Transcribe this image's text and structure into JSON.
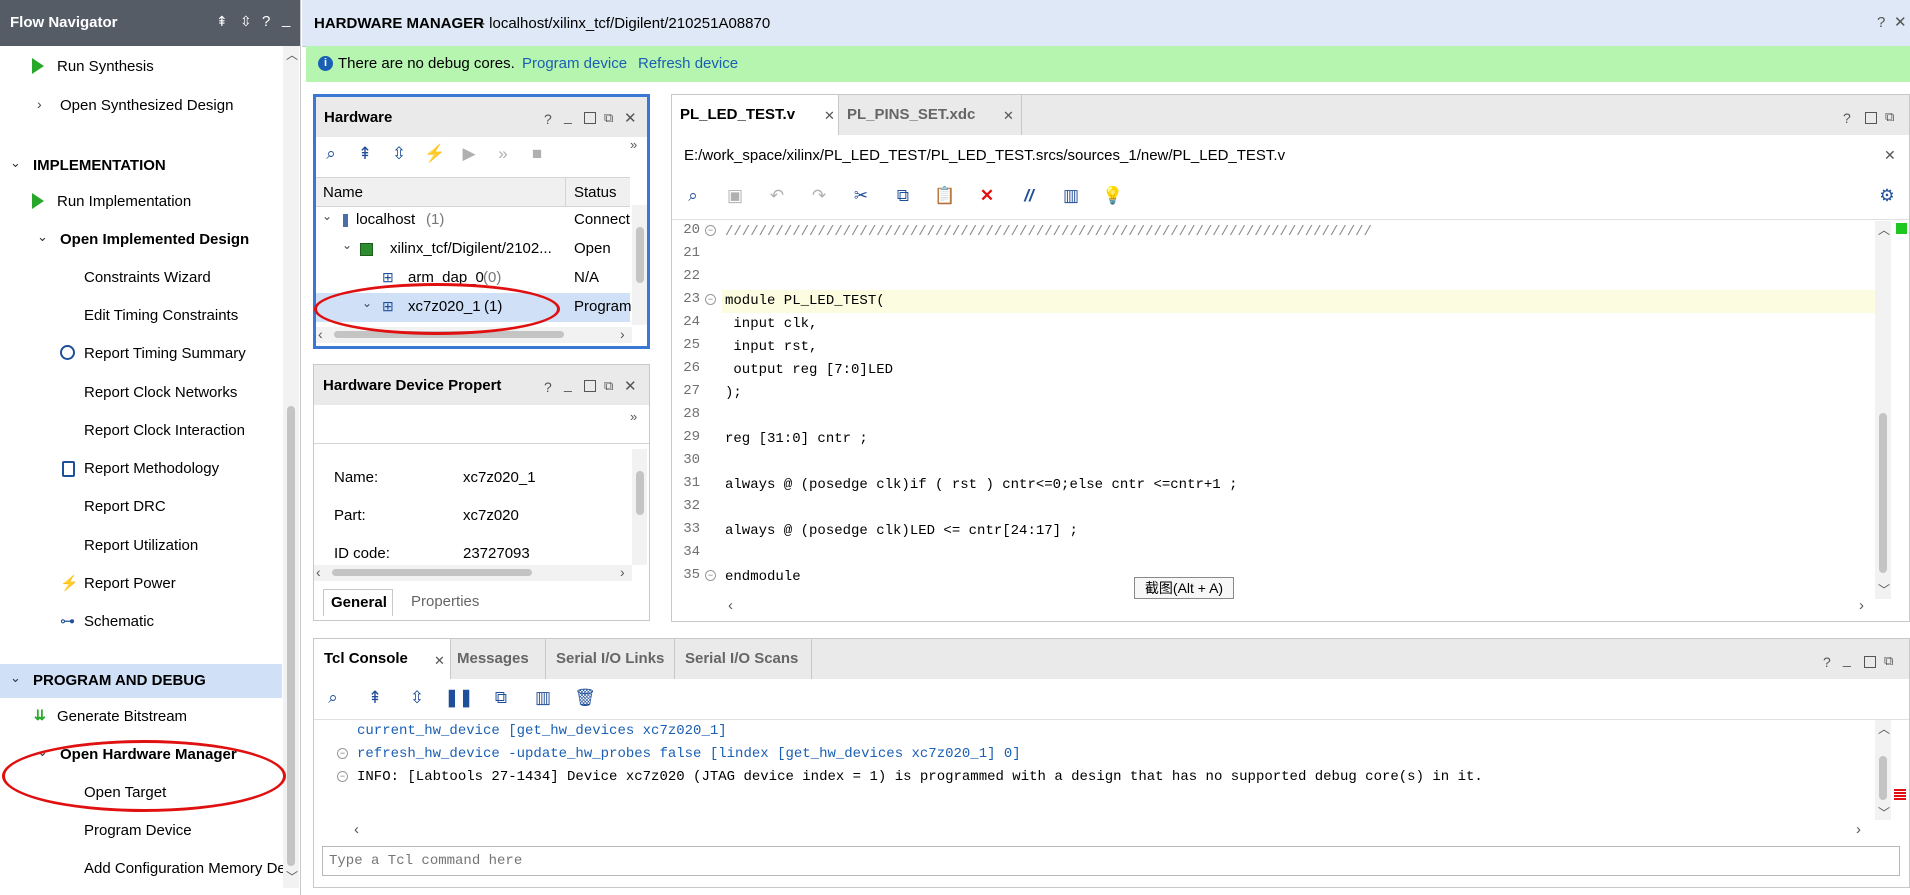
{
  "flow_navigator": {
    "title": "Flow Navigator",
    "items": [
      {
        "label": "Run Synthesis"
      },
      {
        "label": "Open Synthesized Design"
      },
      {
        "label": "IMPLEMENTATION"
      },
      {
        "label": "Run Implementation"
      },
      {
        "label": "Open Implemented Design"
      },
      {
        "label": "Constraints Wizard"
      },
      {
        "label": "Edit Timing Constraints"
      },
      {
        "label": "Report Timing Summary"
      },
      {
        "label": "Report Clock Networks"
      },
      {
        "label": "Report Clock Interaction"
      },
      {
        "label": "Report Methodology"
      },
      {
        "label": "Report DRC"
      },
      {
        "label": "Report Utilization"
      },
      {
        "label": "Report Power"
      },
      {
        "label": "Schematic"
      },
      {
        "label": "PROGRAM AND DEBUG"
      },
      {
        "label": "Generate Bitstream"
      },
      {
        "label": "Open Hardware Manager"
      },
      {
        "label": "Open Target"
      },
      {
        "label": "Program Device"
      },
      {
        "label": "Add Configuration Memory Dev"
      }
    ]
  },
  "header": {
    "title": "HARDWARE MANAGER",
    "path": " - localhost/xilinx_tcf/Digilent/210251A08870"
  },
  "banner": {
    "message": "There are no debug cores.",
    "link1": "Program device",
    "link2": "Refresh device",
    "color": "#b6f5b0"
  },
  "hardware_panel": {
    "title": "Hardware",
    "col_name": "Name",
    "col_status": "Status",
    "rows": [
      {
        "name": "localhost",
        "count": " (1)",
        "status": "Connect"
      },
      {
        "name": "xilinx_tcf/Digilent/2102...",
        "count": "",
        "status": "Open"
      },
      {
        "name": "arm_dap_0",
        "count": " (0)",
        "status": "N/A"
      },
      {
        "name": "xc7z020_1",
        "count": " (1)",
        "status": "Program"
      }
    ]
  },
  "device_props": {
    "title": "Hardware Device Propert",
    "props": [
      {
        "key": "Name:",
        "value": "xc7z020_1"
      },
      {
        "key": "Part:",
        "value": "xc7z020"
      },
      {
        "key": "ID code:",
        "value": "23727093"
      }
    ],
    "tab_general": "General",
    "tab_properties": "Properties"
  },
  "editor": {
    "tabs": [
      {
        "label": "PL_LED_TEST.v"
      },
      {
        "label": "PL_PINS_SET.xdc"
      }
    ],
    "file_path": "E:/work_space/xilinx/PL_LED_TEST/PL_LED_TEST.srcs/sources_1/new/PL_LED_TEST.v",
    "tooltip": "截图(Alt + A)",
    "lines": [
      {
        "n": "20",
        "t": "/////////////////////////////////////////////////////////////////////////////"
      },
      {
        "n": "21",
        "t": ""
      },
      {
        "n": "22",
        "t": ""
      },
      {
        "n": "23",
        "t": "module PL_LED_TEST("
      },
      {
        "n": "24",
        "t": " input clk,"
      },
      {
        "n": "25",
        "t": " input rst,"
      },
      {
        "n": "26",
        "t": " output reg [7:0]LED"
      },
      {
        "n": "27",
        "t": ");"
      },
      {
        "n": "28",
        "t": ""
      },
      {
        "n": "29",
        "t": "reg [31:0] cntr ;"
      },
      {
        "n": "30",
        "t": ""
      },
      {
        "n": "31",
        "t": "always @ (posedge clk)if ( rst ) cntr<=0;else cntr <=cntr+1 ;"
      },
      {
        "n": "32",
        "t": ""
      },
      {
        "n": "33",
        "t": "always @ (posedge clk)LED <= cntr[24:17] ;"
      },
      {
        "n": "34",
        "t": ""
      },
      {
        "n": "35",
        "t": "endmodule"
      }
    ]
  },
  "console": {
    "tabs": [
      {
        "label": "Tcl Console"
      },
      {
        "label": "Messages"
      },
      {
        "label": "Serial I/O Links"
      },
      {
        "label": "Serial I/O Scans"
      }
    ],
    "lines": [
      "current_hw_device [get_hw_devices xc7z020_1]",
      "refresh_hw_device -update_hw_probes false [lindex [get_hw_devices xc7z020_1] 0]",
      "INFO: [Labtools 27-1434] Device xc7z020 (JTAG device index = 1) is programmed with a design that has no supported debug core(s) in it."
    ],
    "input_placeholder": "Type a Tcl command here"
  },
  "colors": {
    "selected_row": "#cfe0f7",
    "highlight_line": "#fcfce0",
    "nav_section_selected": "#cfe0f7",
    "annotation": "#e01010"
  }
}
